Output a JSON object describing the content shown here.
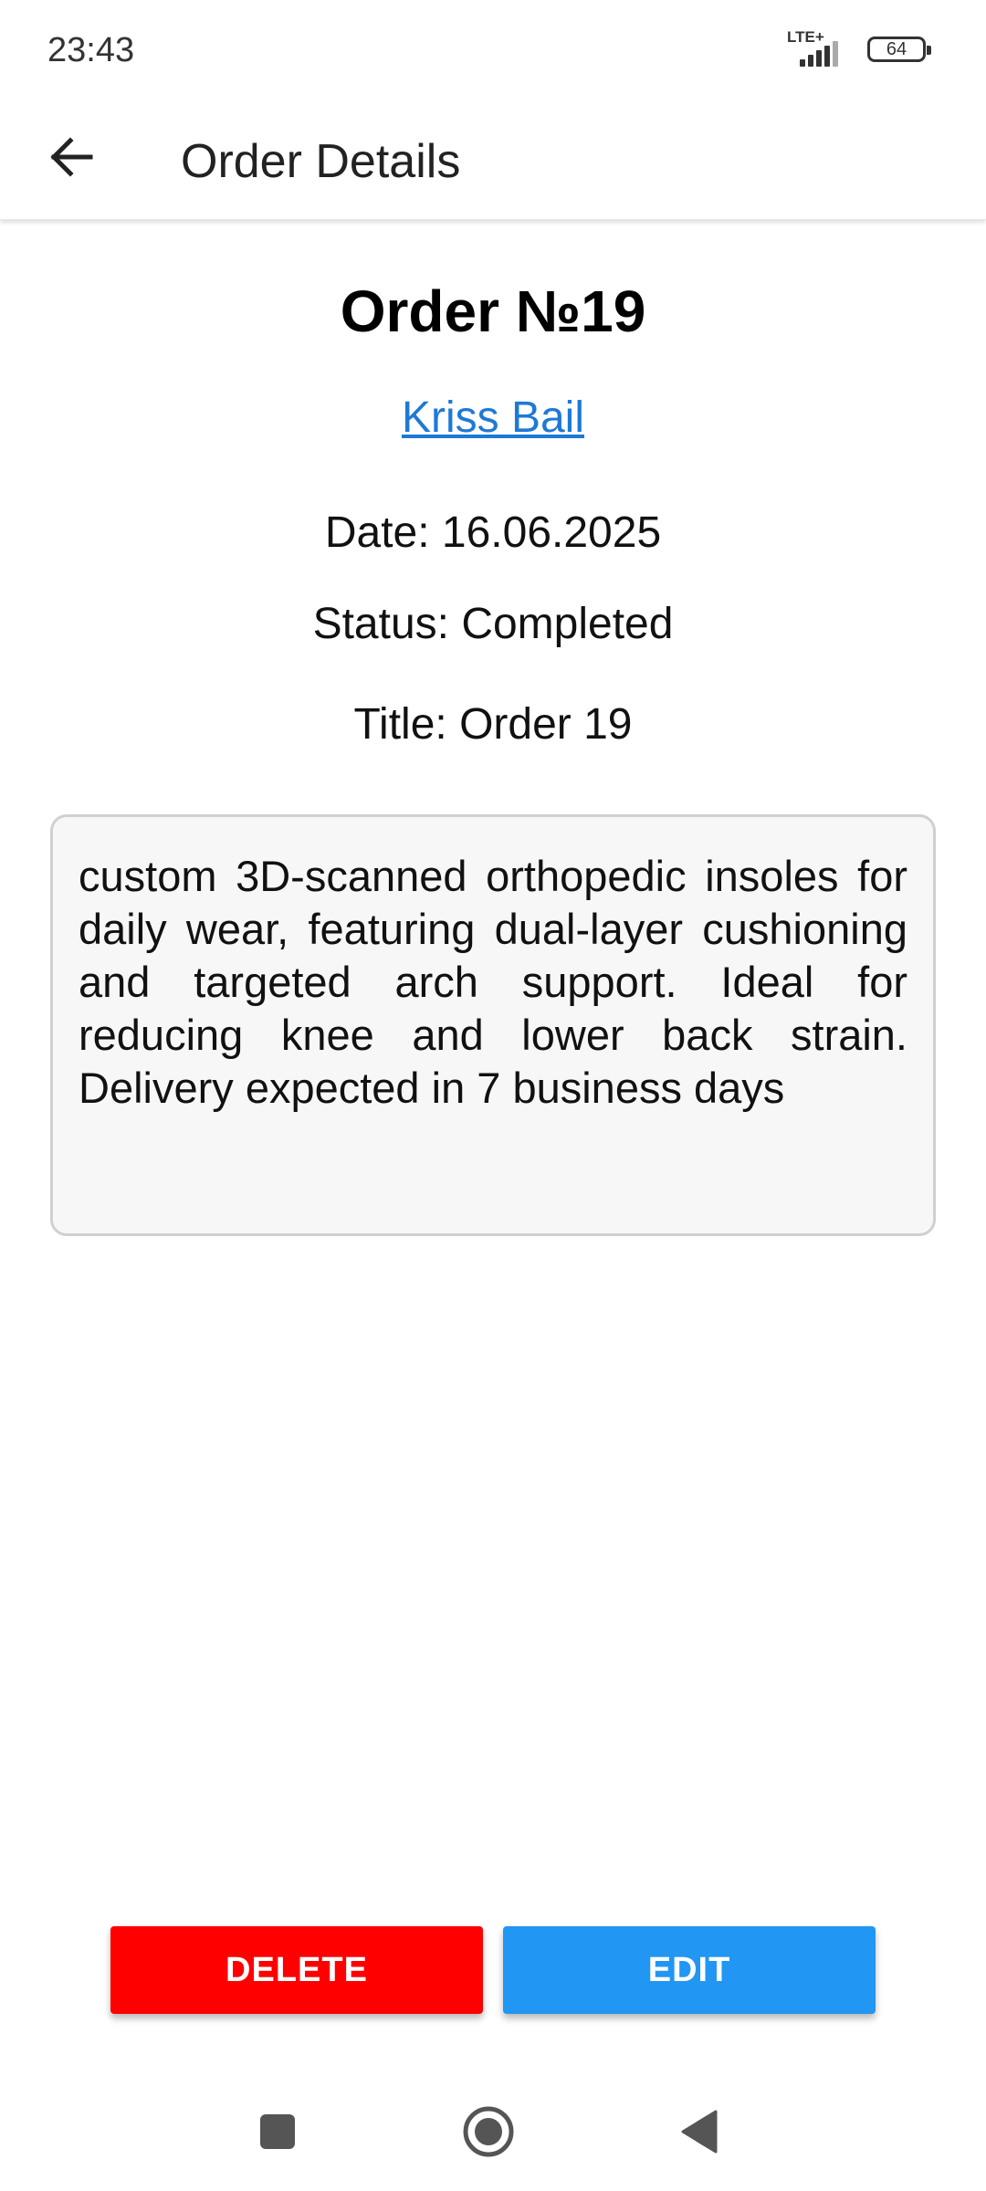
{
  "status_bar": {
    "time": "23:43",
    "network": "LTE+",
    "battery": "64"
  },
  "app_bar": {
    "title": "Order Details",
    "back_icon": "arrow-left-icon"
  },
  "order": {
    "heading": "Order №19",
    "customer": "Kriss Bail",
    "date": "Date: 16.06.2025",
    "status": "Status: Completed",
    "title": "Title: Order 19",
    "description": "custom 3D-scanned orthopedic insoles for daily wear, featuring dual-layer cushioning and targeted arch support. Ideal for reducing knee and lower back strain. Delivery expected in 7 business days"
  },
  "actions": {
    "delete_label": "DELETE",
    "edit_label": "EDIT"
  },
  "colors": {
    "link": "#1e79d6",
    "delete": "#ff0000",
    "edit": "#2196f3"
  },
  "nav": {
    "recents_icon": "square-icon",
    "home_icon": "circle-icon",
    "back_icon": "triangle-back-icon"
  }
}
